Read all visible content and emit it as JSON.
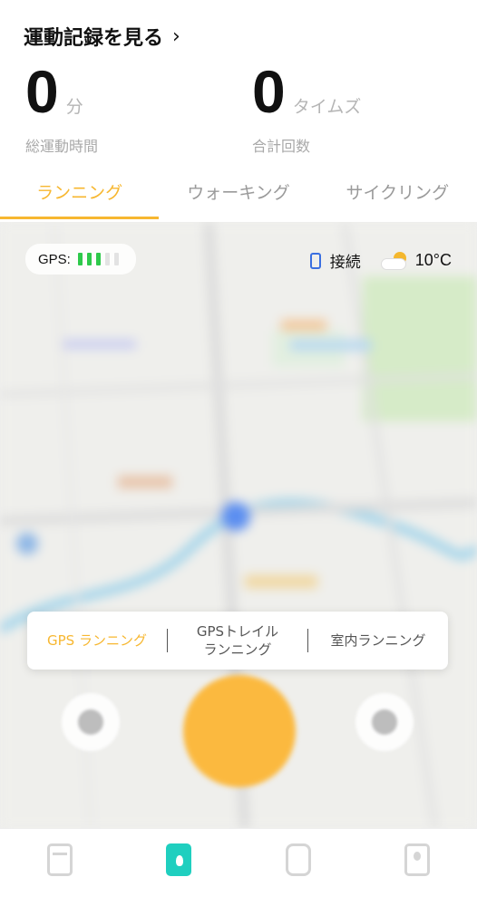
{
  "header": {
    "records_link": "運動記録を見る",
    "records_chevron": "›"
  },
  "stats": {
    "duration": {
      "value": "0",
      "unit": "分",
      "label": "総運動時間"
    },
    "count": {
      "value": "0",
      "unit": "タイムズ",
      "label": "合計回数"
    }
  },
  "tabs": [
    {
      "label": "ランニング",
      "active": true
    },
    {
      "label": "ウォーキング",
      "active": false
    },
    {
      "label": "サイクリング",
      "active": false
    }
  ],
  "status": {
    "gps_label": "GPS:",
    "gps_signal_bars": 3,
    "gps_signal_max": 5,
    "watch_status": "接続",
    "temperature": "10°C"
  },
  "modes": [
    {
      "label": "GPS ランニング",
      "active": true
    },
    {
      "label": "GPSトレイル\nランニング",
      "active": false
    },
    {
      "label": "室内ランニング",
      "active": false
    }
  ],
  "colors": {
    "accent": "#f7b730",
    "tab_active_icon": "#1fcfbf",
    "gps_signal_on": "#2ec94b"
  },
  "icons": {
    "watch": "watch-icon",
    "weather": "partly-cloudy-icon",
    "tabbar": [
      "records-icon",
      "sports-icon",
      "device-icon",
      "profile-icon"
    ]
  }
}
